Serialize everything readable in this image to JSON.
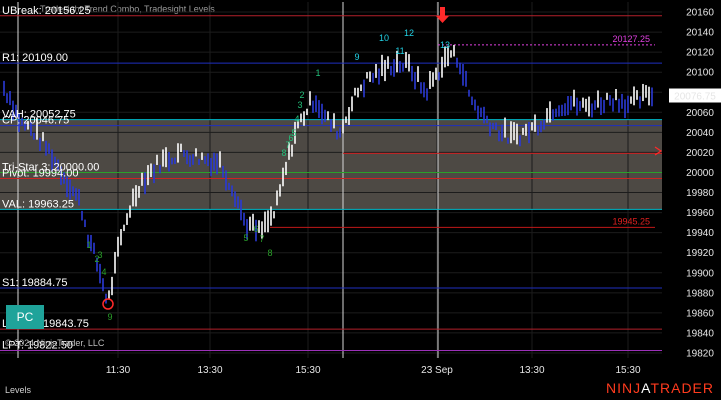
{
  "title": "Tradesight Trend Combo, Tradesight Levels",
  "footer": {
    "label": "Levels",
    "copyright": "© 2024 NinjaTrader, LLC"
  },
  "brand": {
    "part1": "NINJ",
    "part2": "A",
    "part3": "TRADER"
  },
  "badge": "PC",
  "y_axis": {
    "min": 19815,
    "max": 20170,
    "ticks": [
      20160,
      20140,
      20120,
      20100,
      20080,
      20060,
      20040,
      20020,
      20000,
      19980,
      19960,
      19940,
      19920,
      19900,
      19880,
      19860,
      19840,
      19820
    ]
  },
  "price_tag": {
    "label": "20076.75",
    "value": 20076.75
  },
  "x_axis": {
    "ticks": [
      "11:30",
      "13:30",
      "15:30",
      "23 Sep",
      "13:30",
      "15:30"
    ]
  },
  "levels": [
    {
      "label": "UBreak: 20156.25",
      "value": 20156.25,
      "color": "#b3202a",
      "style": "solid"
    },
    {
      "label": "R1: 20109.00",
      "value": 20109.0,
      "color": "#1f2fbf",
      "style": "solid"
    },
    {
      "label": "VAH: 20052.75",
      "value": 20052.75,
      "color": "#00b8c8",
      "style": "solid"
    },
    {
      "label": "CP: 20046.75",
      "value": 20046.75,
      "color": "#1f2fbf",
      "style": "solid"
    },
    {
      "label": "Tri-Star 3: 20000.00",
      "value": 20000.0,
      "color": "#2aa02a",
      "style": "solid"
    },
    {
      "label": "Pivot: 19994.00",
      "value": 19994.0,
      "color": "#cc2222",
      "style": "solid"
    },
    {
      "label": "VAL: 19963.25",
      "value": 19963.25,
      "color": "#00b8c8",
      "style": "solid"
    },
    {
      "label": "S1: 19884.75",
      "value": 19884.75,
      "color": "#1f2fbf",
      "style": "solid"
    },
    {
      "label": "LBreak: 19843.75",
      "value": 19843.75,
      "color": "#b3202a",
      "style": "solid"
    },
    {
      "label": "LPT: 19822.50",
      "value": 19822.5,
      "color": "#9b30b8",
      "style": "solid"
    }
  ],
  "annotations": [
    {
      "label": "20127.25",
      "value": 20127.25,
      "color": "#e040e0"
    },
    {
      "label": "19945.25",
      "value": 19945.25,
      "color": "#e02020"
    }
  ],
  "counts_up": [
    "1",
    "2",
    "3",
    "4",
    "5",
    "6",
    "7",
    "8",
    "9",
    "10",
    "11",
    "12",
    "13"
  ],
  "counts_down": [
    "1",
    "2",
    "3",
    "4",
    "5",
    "6",
    "7",
    "8",
    "9"
  ]
}
